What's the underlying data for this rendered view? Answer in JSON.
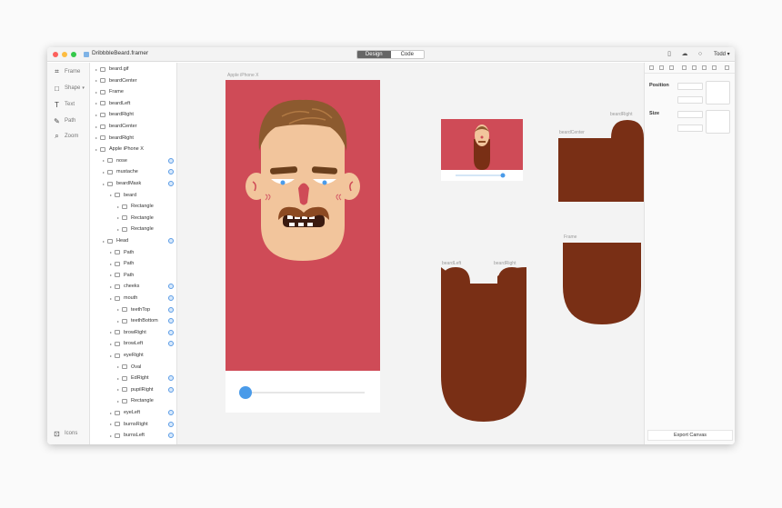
{
  "window": {
    "title": "DribbbleBeard.framer"
  },
  "modes": {
    "design": "Design",
    "code": "Code"
  },
  "user": {
    "name": "Todd"
  },
  "tools": [
    {
      "label": "Frame",
      "icon": "frame-icon"
    },
    {
      "label": "Shape",
      "icon": "shape-icon"
    },
    {
      "label": "Text",
      "icon": "text-icon"
    },
    {
      "label": "Path",
      "icon": "path-icon"
    },
    {
      "label": "Zoom",
      "icon": "zoom-icon"
    }
  ],
  "icons_tool": {
    "label": "Icons"
  },
  "layers": [
    {
      "name": "beard.gif",
      "indent": 0,
      "visible": false
    },
    {
      "name": "beardCenter",
      "indent": 0,
      "visible": false
    },
    {
      "name": "Frame",
      "indent": 0,
      "visible": false
    },
    {
      "name": "beardLeft",
      "indent": 0,
      "visible": false
    },
    {
      "name": "beardRight",
      "indent": 0,
      "visible": false
    },
    {
      "name": "beardCenter",
      "indent": 0,
      "visible": false
    },
    {
      "name": "beardRight",
      "indent": 0,
      "visible": false
    },
    {
      "name": "Apple iPhone X",
      "indent": 0,
      "visible": false
    },
    {
      "name": "nose",
      "indent": 1,
      "visible": true
    },
    {
      "name": "mustache",
      "indent": 1,
      "visible": true
    },
    {
      "name": "beardMask",
      "indent": 1,
      "visible": true
    },
    {
      "name": "beard",
      "indent": 2,
      "visible": false
    },
    {
      "name": "Rectangle",
      "indent": 3,
      "visible": false
    },
    {
      "name": "Rectangle",
      "indent": 3,
      "visible": false
    },
    {
      "name": "Rectangle",
      "indent": 3,
      "visible": false
    },
    {
      "name": "Head",
      "indent": 1,
      "visible": true
    },
    {
      "name": "Path",
      "indent": 2,
      "visible": false
    },
    {
      "name": "Path",
      "indent": 2,
      "visible": false
    },
    {
      "name": "Path",
      "indent": 2,
      "visible": false
    },
    {
      "name": "cheeks",
      "indent": 2,
      "visible": true
    },
    {
      "name": "mouth",
      "indent": 2,
      "visible": true
    },
    {
      "name": "teethTop",
      "indent": 3,
      "visible": true
    },
    {
      "name": "teethBottom",
      "indent": 3,
      "visible": true
    },
    {
      "name": "browRight",
      "indent": 2,
      "visible": true
    },
    {
      "name": "browLeft",
      "indent": 2,
      "visible": true
    },
    {
      "name": "eyeRight",
      "indent": 2,
      "visible": false
    },
    {
      "name": "Oval",
      "indent": 3,
      "visible": false
    },
    {
      "name": "EdRight",
      "indent": 3,
      "visible": true
    },
    {
      "name": "pupilRight",
      "indent": 3,
      "visible": true
    },
    {
      "name": "Rectangle",
      "indent": 3,
      "visible": false
    },
    {
      "name": "eyeLeft",
      "indent": 2,
      "visible": true
    },
    {
      "name": "burnsRight",
      "indent": 2,
      "visible": true
    },
    {
      "name": "burnsLeft",
      "indent": 2,
      "visible": true
    }
  ],
  "canvas": {
    "iphone_label": "Apple iPhone X",
    "beard_right_label": "beardRight",
    "beard_center_label": "beardCenter",
    "frame_label": "Frame",
    "beard_left_label": "beardLeft",
    "beard_right_label2": "beardRight",
    "beard_center_label2": "beardCenter",
    "colors": {
      "screen": "#cf4b57",
      "beard": "#792f15",
      "skin": "#f2c59c",
      "hair": "#8c5a2f",
      "slider": "#4a9be9"
    }
  },
  "inspector": {
    "position_label": "Position",
    "size_label": "Size",
    "export_label": "Export Canvas"
  }
}
